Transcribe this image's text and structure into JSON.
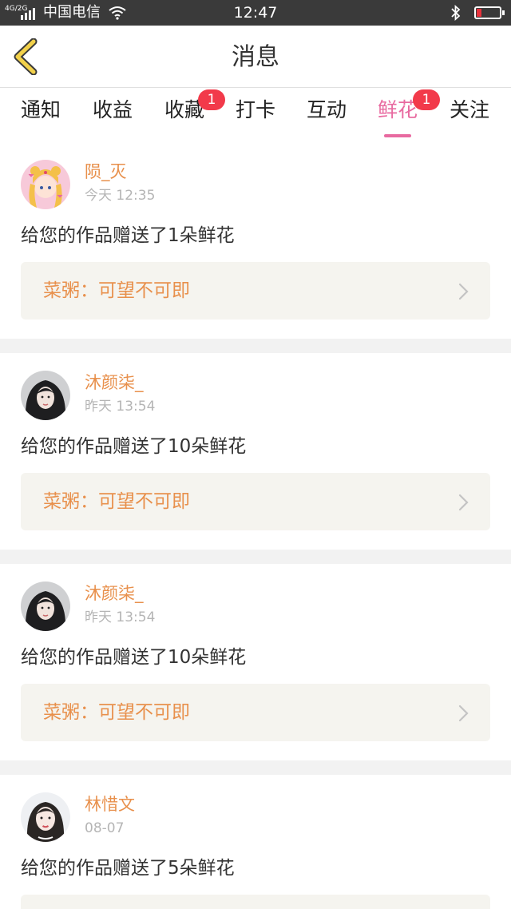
{
  "status_bar": {
    "network": "4G/2G",
    "carrier": "中国电信",
    "time": "12:47"
  },
  "header": {
    "title": "消息"
  },
  "tabs": [
    {
      "label": "通知",
      "badge": ""
    },
    {
      "label": "收益",
      "badge": ""
    },
    {
      "label": "收藏",
      "badge": "1"
    },
    {
      "label": "打卡",
      "badge": ""
    },
    {
      "label": "互动",
      "badge": ""
    },
    {
      "label": "鲜花",
      "badge": "1",
      "active": true
    },
    {
      "label": "关注",
      "badge": ""
    }
  ],
  "messages": [
    {
      "user": "陨_灭",
      "time": "今天 12:35",
      "text": "给您的作品赠送了1朵鲜花",
      "work": "菜粥：可望不可即"
    },
    {
      "user": "沐颜柒_",
      "time": "昨天 13:54",
      "text": "给您的作品赠送了10朵鲜花",
      "work": "菜粥：可望不可即"
    },
    {
      "user": "沐颜柒_",
      "time": "昨天 13:54",
      "text": "给您的作品赠送了10朵鲜花",
      "work": "菜粥：可望不可即"
    },
    {
      "user": "林惜文",
      "time": "08-07",
      "text": "给您的作品赠送了5朵鲜花",
      "work": ""
    }
  ],
  "colors": {
    "accent_pink": "#e86aa0",
    "username_orange": "#e8904c",
    "badge_red": "#f23a4a",
    "back_yellow": "#f2d14a"
  },
  "icons": {
    "back": "chevron-left-icon",
    "wifi": "wifi-icon",
    "bluetooth": "bluetooth-icon",
    "battery": "battery-icon",
    "arrow": "chevron-right-icon"
  }
}
